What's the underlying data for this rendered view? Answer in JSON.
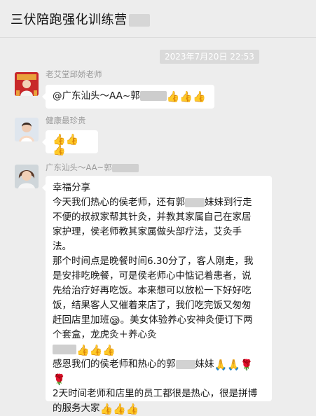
{
  "chat": {
    "title": "三伏陪跑强化训练营",
    "timestamp": "2023年7月20日 22:53"
  },
  "messages": [
    {
      "sender": "老艾堂邱娇老师",
      "prefix": "@广东汕头～AA~郭",
      "thumbs": "👍👍👍"
    },
    {
      "sender": "健康最珍贵",
      "thumbs": "👍👍👍"
    },
    {
      "sender": "广东汕头～AA~郭",
      "lines": {
        "l1": "幸福分享",
        "l2a": "今天我们热心的侯老师，还有郭",
        "l2b": "妹妹到行走",
        "l3": "不便的叔叔家帮其针灸，并教其家属自己在家居",
        "l4": "家护理，侯老师教其家属做头部疗法，艾灸手",
        "l5": "法。",
        "l6": "那个时间点是晚餐时间6.30分了，客人刚走，我",
        "l7": "是安排吃晚餐，可是侯老师心中惦记着患者，说",
        "l8": "先给治疗好再吃饭。本来想可以放松一下好好吃",
        "l9": "饭，结果客人又催着来店了，我们吃完饭又匆匆",
        "l10a": "赶回店里加班",
        "l10b": "。美女体验养心安神灸便订下两",
        "l11": "个套盒，龙虎灸＋养心灸",
        "l13a": "感恩我们的侯老师和热心的郭",
        "l13b": "妹妹",
        "l15": "2天时间老师和店里的员工都很是热心，很是拼博",
        "l16": "的服务大家"
      },
      "emoji": {
        "tired": "😪",
        "thumbs_three": "👍👍👍",
        "pray_two": "🙏🙏",
        "rose": "🌹"
      }
    }
  ]
}
